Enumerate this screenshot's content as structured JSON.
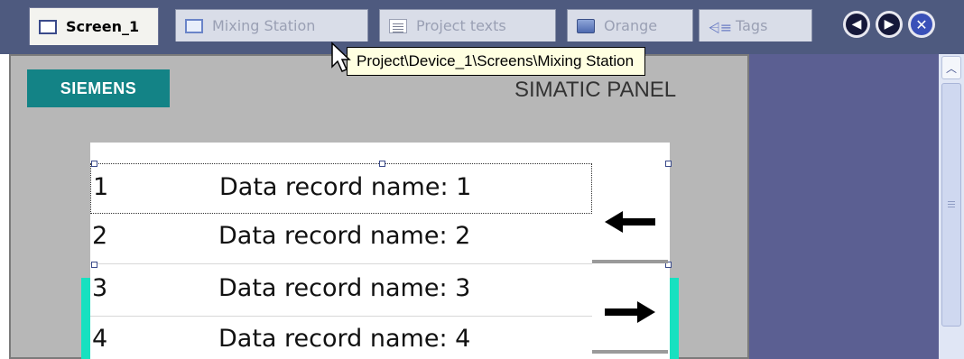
{
  "tabs": [
    {
      "label": "Screen_1",
      "icon": "screen-icon",
      "active": true
    },
    {
      "label": "Mixing Station",
      "icon": "screen-icon",
      "active": false
    },
    {
      "label": "Project texts",
      "icon": "project-texts-icon",
      "active": false
    },
    {
      "label": "Orange",
      "icon": "orange-icon",
      "active": false
    },
    {
      "label": "Tags",
      "icon": "tags-icon",
      "active": false
    }
  ],
  "nav": {
    "prev_icon": "arrow-left-icon",
    "next_icon": "arrow-right-icon",
    "close_icon": "close-icon"
  },
  "tooltip": "Project\\Device_1\\Screens\\Mixing Station",
  "panel": {
    "brand": "SIEMENS",
    "model": "SIMATIC PANEL"
  },
  "recipe": {
    "rows": [
      {
        "num": "1",
        "name": "Data record name: 1"
      },
      {
        "num": "2",
        "name": "Data record name: 2"
      },
      {
        "num": "3",
        "name": "Data record name: 3"
      },
      {
        "num": "4",
        "name": "Data record name: 4"
      }
    ],
    "buttons": [
      {
        "icon": "arrow-left-icon"
      },
      {
        "icon": "arrow-right-icon"
      }
    ]
  },
  "colors": {
    "brand": "#138386",
    "tab_strip": "#4e5a7f",
    "highlight": "#17e1c0",
    "tooltip": "#ffffe1"
  }
}
